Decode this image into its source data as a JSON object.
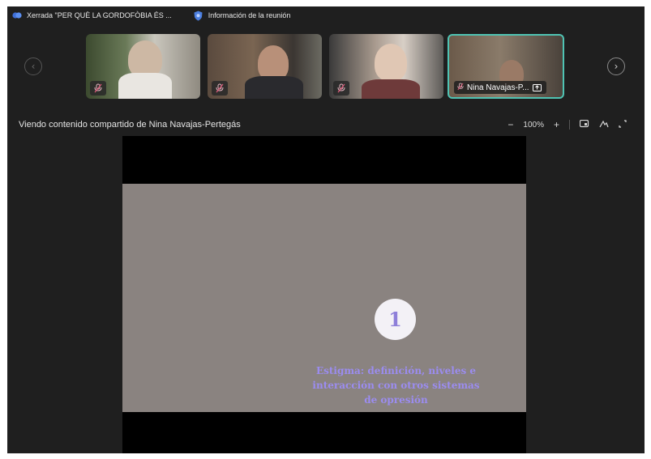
{
  "titlebar": {
    "meeting_title": "Xerrada \"PER QUÈ LA GORDOFÒBIA ÉS ...",
    "meeting_info": "Información de la reunión"
  },
  "participants": [
    {
      "name": "",
      "muted": true
    },
    {
      "name": "",
      "muted": true
    },
    {
      "name": "",
      "muted": true
    },
    {
      "name": "Nina Navajas-P...",
      "muted": true,
      "sharing": true,
      "active": true
    }
  ],
  "sharebar": {
    "label": "Viendo contenido compartido de Nina Navajas-Pertegás",
    "zoom_out": "−",
    "zoom_level": "100%",
    "zoom_in": "+"
  },
  "slide": {
    "number": "1",
    "line1": "Estigma: definición, niveles e",
    "line2": "interacción con otros sistemas",
    "line3": "de opresión"
  },
  "colors": {
    "background": "#1f1f1f",
    "active_border": "#4fc3b3",
    "slide_bg": "#8a8380",
    "slide_text": "#9b8cf0"
  }
}
